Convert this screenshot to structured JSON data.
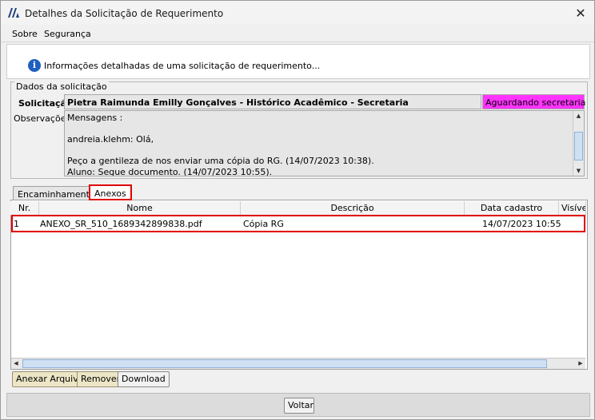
{
  "window": {
    "title": "Detalhes da Solicitação de Requerimento",
    "close_symbol": "✕"
  },
  "menu": {
    "items": [
      "Sobre",
      "Segurança"
    ]
  },
  "header": {
    "info_text": "Informações detalhadas de uma solicitação de requerimento..."
  },
  "dados": {
    "legend": "Dados da solicitação",
    "solicitacao_label": "Solicitação:",
    "solicitacao_value": "Pietra Raimunda Emilly Gonçalves - Histórico Acadêmico - Secretaria",
    "status": "Aguardando secretaria",
    "status_color": "#ff33ff",
    "observacoes_label": "Observações:",
    "observacoes_text": "Mensagens :\n\nandreia.klehm: Olá,\n\nPeço a gentileza de nos enviar uma cópia do RG. (14/07/2023 10:38).\nAluno: Segue documento. (14/07/2023 10:55)."
  },
  "tabs": [
    {
      "label": "Encaminhamentos",
      "active": false
    },
    {
      "label": "Anexos",
      "active": true
    }
  ],
  "table": {
    "columns": [
      "Nr.",
      "Nome",
      "Descrição",
      "Data cadastro",
      "Visível"
    ],
    "rows": [
      {
        "nr": "1",
        "nome": "ANEXO_SR_510_1689342899838.pdf",
        "descricao": "Cópia RG",
        "data_cadastro": "14/07/2023 10:55",
        "visivel": ""
      }
    ]
  },
  "buttons": {
    "anexar": "Anexar Arquivo",
    "remover": "Remover",
    "download": "Download",
    "voltar": "Voltar"
  },
  "colors": {
    "highlight": "#e00000",
    "info_icon": "#1f5fbf"
  }
}
